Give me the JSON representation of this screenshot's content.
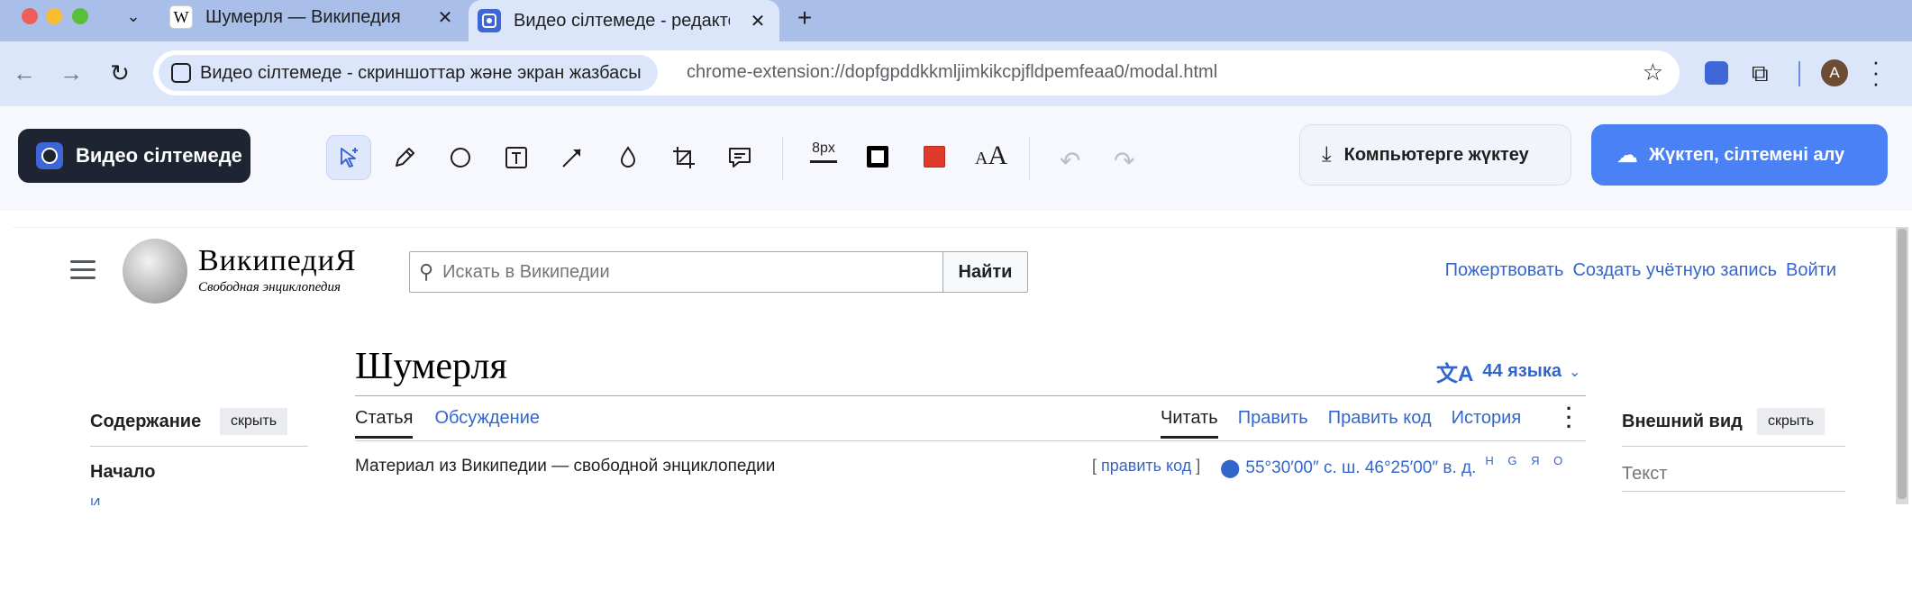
{
  "browser": {
    "tabs": [
      {
        "title": "Шумерля — Википедия",
        "favicon": "W"
      },
      {
        "title": "Видео сілтемеде - редактор",
        "favicon": ""
      }
    ],
    "omnibox": {
      "site_name": "Видео сілтемеде - скриншоттар және экран жазбасы",
      "url": "chrome-extension://dopfgpddkkmljimkikcpjfldpemfeaa0/modal.html"
    },
    "profile_initial": "A"
  },
  "editor": {
    "brand_name": "Видео сілтемеде",
    "tools": [
      "select-icon",
      "pencil-icon",
      "ellipse-icon",
      "text-icon",
      "arrow-icon",
      "blur-drop-icon",
      "crop-icon",
      "comment-icon"
    ],
    "stroke_size": "8px",
    "colors": {
      "stroke": "#000000",
      "fill": "#e03a2a"
    },
    "font_glyph": "AA",
    "download_label": "Компьютерге жүктеу",
    "upload_label": "Жүктеп, сілтемені алу"
  },
  "wiki": {
    "wordmark": "ВикипедиЯ",
    "tagline": "Свободная энциклопедия",
    "search_placeholder": "Искать в Википедии",
    "search_button": "Найти",
    "user_links": [
      "Пожертвовать",
      "Создать учётную запись",
      "Войти"
    ],
    "title": "Шумерля",
    "languages": "44 языка",
    "tabs_left": [
      "Статья",
      "Обсуждение"
    ],
    "tabs_right": [
      "Читать",
      "Править",
      "Править код",
      "История"
    ],
    "from_line": "Материал из Википедии — свободной энциклопедии",
    "edit_code": "править код",
    "coords": "55°30′00″ с. ш. 46°25′00″ в. д.",
    "map_links": "Н G Я О",
    "toc_heading": "Содержание",
    "hide_label": "скрыть",
    "toc_start": "Начало",
    "appearance_heading": "Внешний вид",
    "appearance_text": "Текст"
  }
}
